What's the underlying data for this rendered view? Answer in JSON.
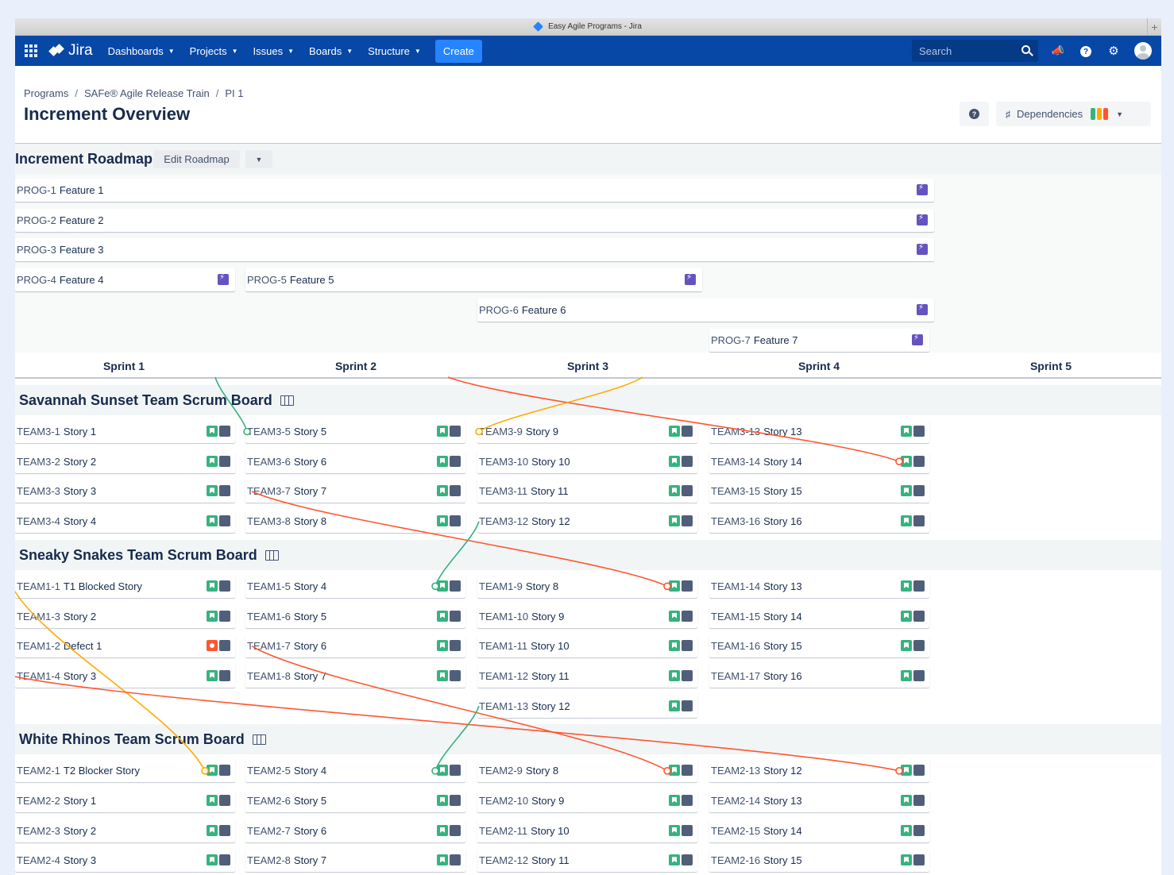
{
  "window": {
    "title": "Easy Agile Programs - Jira"
  },
  "nav": {
    "logo": "Jira",
    "items": [
      {
        "label": "Dashboards"
      },
      {
        "label": "Projects"
      },
      {
        "label": "Issues"
      },
      {
        "label": "Boards"
      },
      {
        "label": "Structure"
      }
    ],
    "create_label": "Create",
    "search_placeholder": "Search"
  },
  "breadcrumb": [
    "Programs",
    "SAFe® Agile Release Train",
    "PI 1"
  ],
  "page_title": "Increment Overview",
  "dependencies": {
    "label": "Dependencies",
    "colors": [
      "#36b37e",
      "#ffab00",
      "#ff5630"
    ]
  },
  "roadmap": {
    "title": "Increment Roadmap",
    "edit_label": "Edit Roadmap",
    "features": [
      {
        "key": "PROG-1",
        "summary": "Feature 1",
        "start": 1,
        "end": 4,
        "row": 0
      },
      {
        "key": "PROG-2",
        "summary": "Feature 2",
        "start": 1,
        "end": 4,
        "row": 1
      },
      {
        "key": "PROG-3",
        "summary": "Feature 3",
        "start": 1,
        "end": 4,
        "row": 2
      },
      {
        "key": "PROG-4",
        "summary": "Feature 4",
        "start": 1,
        "end": 1,
        "row": 3
      },
      {
        "key": "PROG-5",
        "summary": "Feature 5",
        "start": 2,
        "end": 3,
        "row": 3
      },
      {
        "key": "PROG-6",
        "summary": "Feature 6",
        "start": 3,
        "end": 4,
        "row": 4
      },
      {
        "key": "PROG-7",
        "summary": "Feature 7",
        "start": 4,
        "end": 4,
        "row": 5
      }
    ]
  },
  "sprints": [
    "Sprint 1",
    "Sprint 2",
    "Sprint 3",
    "Sprint 4",
    "Sprint 5"
  ],
  "boards": [
    {
      "name": "Savannah Sunset Team Scrum Board",
      "rows": 4,
      "issues": [
        {
          "key": "TEAM3-1",
          "summary": "Story 1",
          "sprint": 1,
          "row": 0,
          "type": "story"
        },
        {
          "key": "TEAM3-2",
          "summary": "Story 2",
          "sprint": 1,
          "row": 1,
          "type": "story"
        },
        {
          "key": "TEAM3-3",
          "summary": "Story 3",
          "sprint": 1,
          "row": 2,
          "type": "story"
        },
        {
          "key": "TEAM3-4",
          "summary": "Story 4",
          "sprint": 1,
          "row": 3,
          "type": "story"
        },
        {
          "key": "TEAM3-5",
          "summary": "Story 5",
          "sprint": 2,
          "row": 0,
          "type": "story"
        },
        {
          "key": "TEAM3-6",
          "summary": "Story 6",
          "sprint": 2,
          "row": 1,
          "type": "story"
        },
        {
          "key": "TEAM3-7",
          "summary": "Story 7",
          "sprint": 2,
          "row": 2,
          "type": "story"
        },
        {
          "key": "TEAM3-8",
          "summary": "Story 8",
          "sprint": 2,
          "row": 3,
          "type": "story"
        },
        {
          "key": "TEAM3-9",
          "summary": "Story 9",
          "sprint": 3,
          "row": 0,
          "type": "story"
        },
        {
          "key": "TEAM3-10",
          "summary": "Story 10",
          "sprint": 3,
          "row": 1,
          "type": "story"
        },
        {
          "key": "TEAM3-11",
          "summary": "Story 11",
          "sprint": 3,
          "row": 2,
          "type": "story"
        },
        {
          "key": "TEAM3-12",
          "summary": "Story 12",
          "sprint": 3,
          "row": 3,
          "type": "story"
        },
        {
          "key": "TEAM3-13",
          "summary": "Story 13",
          "sprint": 4,
          "row": 0,
          "type": "story"
        },
        {
          "key": "TEAM3-14",
          "summary": "Story 14",
          "sprint": 4,
          "row": 1,
          "type": "story"
        },
        {
          "key": "TEAM3-15",
          "summary": "Story 15",
          "sprint": 4,
          "row": 2,
          "type": "story"
        },
        {
          "key": "TEAM3-16",
          "summary": "Story 16",
          "sprint": 4,
          "row": 3,
          "type": "story"
        }
      ]
    },
    {
      "name": "Sneaky Snakes Team Scrum Board",
      "rows": 5,
      "issues": [
        {
          "key": "TEAM1-1",
          "summary": "T1 Blocked Story",
          "sprint": 1,
          "row": 0,
          "type": "story"
        },
        {
          "key": "TEAM1-3",
          "summary": "Story 2",
          "sprint": 1,
          "row": 1,
          "type": "story"
        },
        {
          "key": "TEAM1-2",
          "summary": "Defect 1",
          "sprint": 1,
          "row": 2,
          "type": "bug"
        },
        {
          "key": "TEAM1-4",
          "summary": "Story 3",
          "sprint": 1,
          "row": 3,
          "type": "story"
        },
        {
          "key": "TEAM1-5",
          "summary": "Story 4",
          "sprint": 2,
          "row": 0,
          "type": "story"
        },
        {
          "key": "TEAM1-6",
          "summary": "Story 5",
          "sprint": 2,
          "row": 1,
          "type": "story"
        },
        {
          "key": "TEAM1-7",
          "summary": "Story 6",
          "sprint": 2,
          "row": 2,
          "type": "story"
        },
        {
          "key": "TEAM1-8",
          "summary": "Story 7",
          "sprint": 2,
          "row": 3,
          "type": "story"
        },
        {
          "key": "TEAM1-9",
          "summary": "Story 8",
          "sprint": 3,
          "row": 0,
          "type": "story"
        },
        {
          "key": "TEAM1-10",
          "summary": "Story 9",
          "sprint": 3,
          "row": 1,
          "type": "story"
        },
        {
          "key": "TEAM1-11",
          "summary": "Story 10",
          "sprint": 3,
          "row": 2,
          "type": "story"
        },
        {
          "key": "TEAM1-12",
          "summary": "Story 11",
          "sprint": 3,
          "row": 3,
          "type": "story"
        },
        {
          "key": "TEAM1-13",
          "summary": "Story 12",
          "sprint": 3,
          "row": 4,
          "type": "story"
        },
        {
          "key": "TEAM1-14",
          "summary": "Story 13",
          "sprint": 4,
          "row": 0,
          "type": "story"
        },
        {
          "key": "TEAM1-15",
          "summary": "Story 14",
          "sprint": 4,
          "row": 1,
          "type": "story"
        },
        {
          "key": "TEAM1-16",
          "summary": "Story 15",
          "sprint": 4,
          "row": 2,
          "type": "story"
        },
        {
          "key": "TEAM1-17",
          "summary": "Story 16",
          "sprint": 4,
          "row": 3,
          "type": "story"
        }
      ]
    },
    {
      "name": "White Rhinos Team Scrum Board",
      "rows": 4,
      "issues": [
        {
          "key": "TEAM2-1",
          "summary": "T2 Blocker Story",
          "sprint": 1,
          "row": 0,
          "type": "story"
        },
        {
          "key": "TEAM2-2",
          "summary": "Story 1",
          "sprint": 1,
          "row": 1,
          "type": "story"
        },
        {
          "key": "TEAM2-3",
          "summary": "Story 2",
          "sprint": 1,
          "row": 2,
          "type": "story"
        },
        {
          "key": "TEAM2-4",
          "summary": "Story 3",
          "sprint": 1,
          "row": 3,
          "type": "story"
        },
        {
          "key": "TEAM2-5",
          "summary": "Story 4",
          "sprint": 2,
          "row": 0,
          "type": "story"
        },
        {
          "key": "TEAM2-6",
          "summary": "Story 5",
          "sprint": 2,
          "row": 1,
          "type": "story"
        },
        {
          "key": "TEAM2-7",
          "summary": "Story 6",
          "sprint": 2,
          "row": 2,
          "type": "story"
        },
        {
          "key": "TEAM2-8",
          "summary": "Story 7",
          "sprint": 2,
          "row": 3,
          "type": "story"
        },
        {
          "key": "TEAM2-9",
          "summary": "Story 8",
          "sprint": 3,
          "row": 0,
          "type": "story"
        },
        {
          "key": "TEAM2-10",
          "summary": "Story 9",
          "sprint": 3,
          "row": 1,
          "type": "story"
        },
        {
          "key": "TEAM2-11",
          "summary": "Story 10",
          "sprint": 3,
          "row": 2,
          "type": "story"
        },
        {
          "key": "TEAM2-12",
          "summary": "Story 11",
          "sprint": 3,
          "row": 3,
          "type": "story"
        },
        {
          "key": "TEAM2-13",
          "summary": "Story 12",
          "sprint": 4,
          "row": 0,
          "type": "story"
        },
        {
          "key": "TEAM2-14",
          "summary": "Story 13",
          "sprint": 4,
          "row": 1,
          "type": "story"
        },
        {
          "key": "TEAM2-15",
          "summary": "Story 14",
          "sprint": 4,
          "row": 2,
          "type": "story"
        },
        {
          "key": "TEAM2-16",
          "summary": "Story 15",
          "sprint": 4,
          "row": 3,
          "type": "story"
        }
      ]
    }
  ],
  "dependency_colors": {
    "healthy": "#36b37e",
    "warning": "#ffab00",
    "blocked": "#ff5630"
  },
  "dependency_links": [
    {
      "from": "TEAM3-5",
      "to": null,
      "status": "healthy"
    },
    {
      "from": "TEAM3-14",
      "to": null,
      "status": "blocked"
    },
    {
      "from": "TEAM3-9",
      "to": null,
      "status": "warning"
    },
    {
      "from": "TEAM3-7",
      "to": "TEAM1-9",
      "status": "blocked"
    },
    {
      "from": "TEAM3-12",
      "to": "TEAM1-5",
      "status": "healthy"
    },
    {
      "from": "TEAM1-1",
      "to": "TEAM2-1",
      "status": "warning"
    },
    {
      "from": "TEAM1-7",
      "to": "TEAM2-9",
      "status": "blocked"
    },
    {
      "from": "TEAM1-4",
      "to": "TEAM2-13",
      "status": "blocked"
    },
    {
      "from": "TEAM1-13",
      "to": "TEAM2-5",
      "status": "healthy"
    }
  ]
}
